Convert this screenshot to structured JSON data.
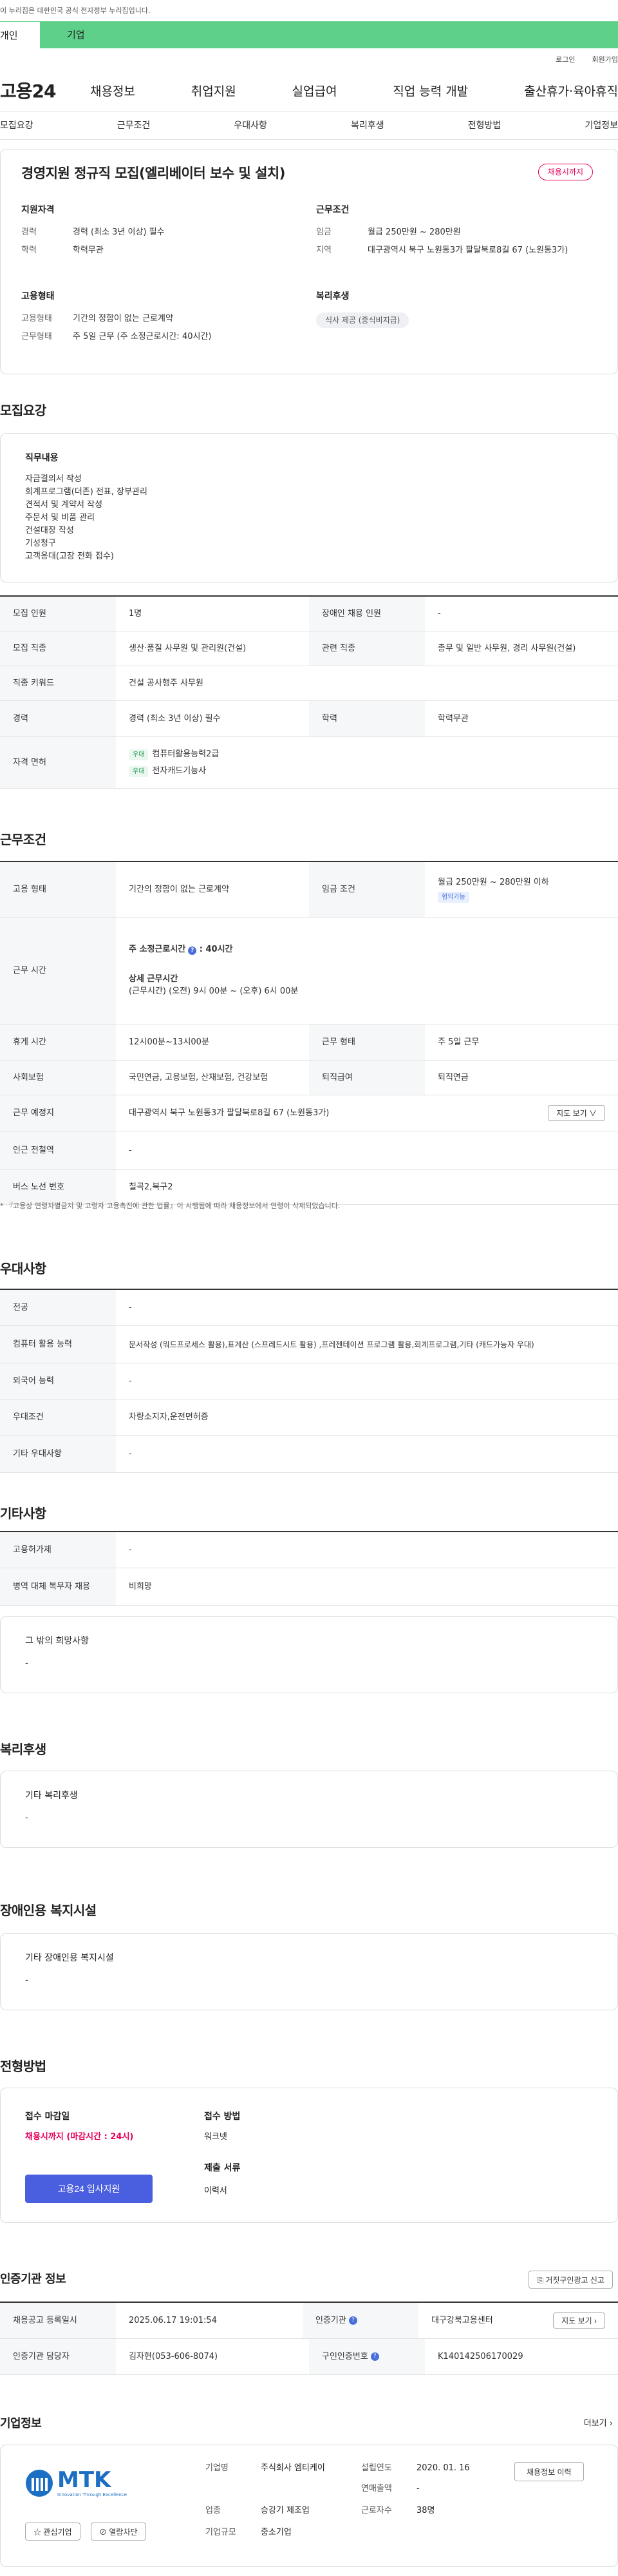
{
  "gov_banner": "이 누리집은 대한민국 공식 전자정부 누리집입니다.",
  "top_tabs": [
    "개인",
    "기업"
  ],
  "util": [
    "로그인",
    "회원가입"
  ],
  "logo": "고용24",
  "gnb": [
    "채용정보",
    "취업지원",
    "실업급여",
    "직업 능력 개발",
    "출산휴가·육아휴직"
  ],
  "tabs": [
    "모집요강",
    "근무조건",
    "우대사항",
    "복리후생",
    "전형방법",
    "기업정보"
  ],
  "summary": {
    "title": "경영지원 정규직 모집(엘리베이터 보수 및 설치)",
    "badge": "채용시까지",
    "qual_title": "지원자격",
    "qual": [
      {
        "k": "경력",
        "v": "경력 (최소 3년 이상) 필수"
      },
      {
        "k": "학력",
        "v": "학력무관"
      }
    ],
    "emp_title": "고용형태",
    "emp": [
      {
        "k": "고용형태",
        "v": "기간의 정함이 없는 근로계약"
      },
      {
        "k": "근무형태",
        "v": "주 5일 근무 (주 소정근로시간: 40시간)"
      }
    ],
    "cond_title": "근무조건",
    "cond": [
      {
        "k": "임금",
        "v": "월급 250만원 ~ 280만원"
      },
      {
        "k": "지역",
        "v": "대구광역시 북구 노원동3가 팔달북로8길 67 (노원동3가)"
      }
    ],
    "welfare_title": "복리후생",
    "welfare_chip": "식사 제공 (중식비지급)"
  },
  "recruit": {
    "title": "모집요강",
    "duty_label": "직무내용",
    "duties": [
      "자금결의서 작성",
      "회계프로그램(더존) 전표, 장부관리",
      "견적서 및 계약서 작성",
      "주문서 및 비품 관리",
      "건설대장 작성",
      "기성청구",
      "고객응대(고장 전화 접수)"
    ],
    "rows": {
      "r1": {
        "k1": "모집 인원",
        "v1": "1명",
        "k2": "장애인 채용 인원",
        "v2": "-"
      },
      "r2": {
        "k1": "모집 직종",
        "v1": "생산·품질 사무원 및 관리원(건설)",
        "k2": "관련 직종",
        "v2": "총무 및 일반 사무원, 경리 사무원(건설)"
      },
      "r3": {
        "k1": "직종 키워드",
        "v1": "건설 공사행주 사무원"
      },
      "r4": {
        "k1": "경력",
        "v1": "경력 (최소 3년 이상) 필수",
        "k2": "학력",
        "v2": "학력무관"
      },
      "r5": {
        "k1": "자격 면허",
        "tag": "우대",
        "lic1": "컴퓨터활용능력2급",
        "lic2": "전자캐드기능사"
      }
    }
  },
  "work": {
    "title": "근무조건",
    "r1": {
      "k1": "고용 형태",
      "v1": "기간의 정함이 없는 근로계약",
      "k2": "임금 조건",
      "v2": "월급 250만원 ~ 280만원 이하",
      "tag": "협의가능"
    },
    "r2": {
      "k1": "근무 시간",
      "a": "주 소정근로시간",
      "b": ": 40시간",
      "c": "상세 근무시간",
      "d": "(근무시간) (오전) 9시 00분 ~ (오후) 6시 00분"
    },
    "r3": {
      "k1": "휴게 시간",
      "v1": "12시00분~13시00분",
      "k2": "근무 형태",
      "v2": "주 5일 근무"
    },
    "r4": {
      "k1": "사회보험",
      "v1": "국민연금, 고용보험, 산재보험, 건강보험",
      "k2": "퇴직급여",
      "v2": "퇴직연금"
    },
    "r5": {
      "k1": "근무 예정지",
      "v1": "대구광역시 북구 노원동3가 팔달북로8길 67 (노원동3가)",
      "btn": "지도 보기 ∨"
    },
    "r6": {
      "k1": "인근 전철역",
      "v1": "-"
    },
    "r7": {
      "k1": "버스 노선 번호",
      "v1": "칠곡2,북구2"
    },
    "note": "* 『고용상 연령차별금지 및 고령자 고용촉진에 관한 법률』이 시행됨에 따라 채용정보에서 연령이 삭제되었습니다."
  },
  "pref": {
    "title": "우대사항",
    "rows": [
      {
        "k": "전공",
        "v": "-"
      },
      {
        "k": "컴퓨터 활용 능력",
        "v": "문서작성 (워드프로세스 활용),표계산 (스프레드시트 활용) ,프레젠테이션 프로그램 활용,회계프로그램,기타 (캐드가능자 우대)"
      },
      {
        "k": "외국어 능력",
        "v": "-"
      },
      {
        "k": "우대조건",
        "v": "차량소지자,운전면허증"
      },
      {
        "k": "기타 우대사항",
        "v": "-"
      }
    ]
  },
  "etc": {
    "title": "기타사항",
    "rows": [
      {
        "k": "고용허가제",
        "v": "-"
      },
      {
        "k": "병역 대체 복무자 채용",
        "v": "비희망"
      }
    ],
    "hope_label": "그 밖의 희망사항",
    "hope_value": "-"
  },
  "welfare": {
    "title": "복리후생",
    "label": "기타 복리후생",
    "value": "-"
  },
  "disabled": {
    "title": "장애인용 복지시설",
    "label": "기타 장애인용 복지시설",
    "value": "-"
  },
  "process": {
    "title": "전형방법",
    "deadline_label": "접수 마감일",
    "deadline_value": "채용시까지 (마감시간 : 24시)",
    "apply_btn": "고용24 입사지원",
    "method_label": "접수 방법",
    "method_value": "워크넷",
    "docs_label": "제출 서류",
    "docs_value": "이력서"
  },
  "cert": {
    "title": "인증기관 정보",
    "report_btn": "거짓구인광고 신고",
    "r1": {
      "k1": "채용공고 등록일시",
      "v1": "2025.06.17 19:01:54",
      "k2": "인증기관",
      "v2": "대구강북고용센터",
      "btn": "지도 보기"
    },
    "r2": {
      "k1": "인증기관 담당자",
      "v1": "김자현(053-606-8074)",
      "k2": "구인인증번호",
      "v2": "K140142506170029"
    }
  },
  "company": {
    "title": "기업정보",
    "more": "더보기",
    "logo_text": "MTK",
    "logo_sub": "Innovation Through Excellence",
    "interest_btn": "관심기업",
    "block_btn": "열람차단",
    "name_k": "기업명",
    "name_v": "주식회사 엠티케이",
    "industry_k": "업종",
    "industry_v": "승강기 제조업",
    "scale_k": "기업규모",
    "scale_v": "중소기업",
    "est_k": "설립연도",
    "est_v": "2020. 01. 16",
    "sales_k": "연매출액",
    "sales_v": "-",
    "emp_k": "근로자수",
    "emp_v": "38명",
    "history_btn": "채용정보 이력"
  }
}
